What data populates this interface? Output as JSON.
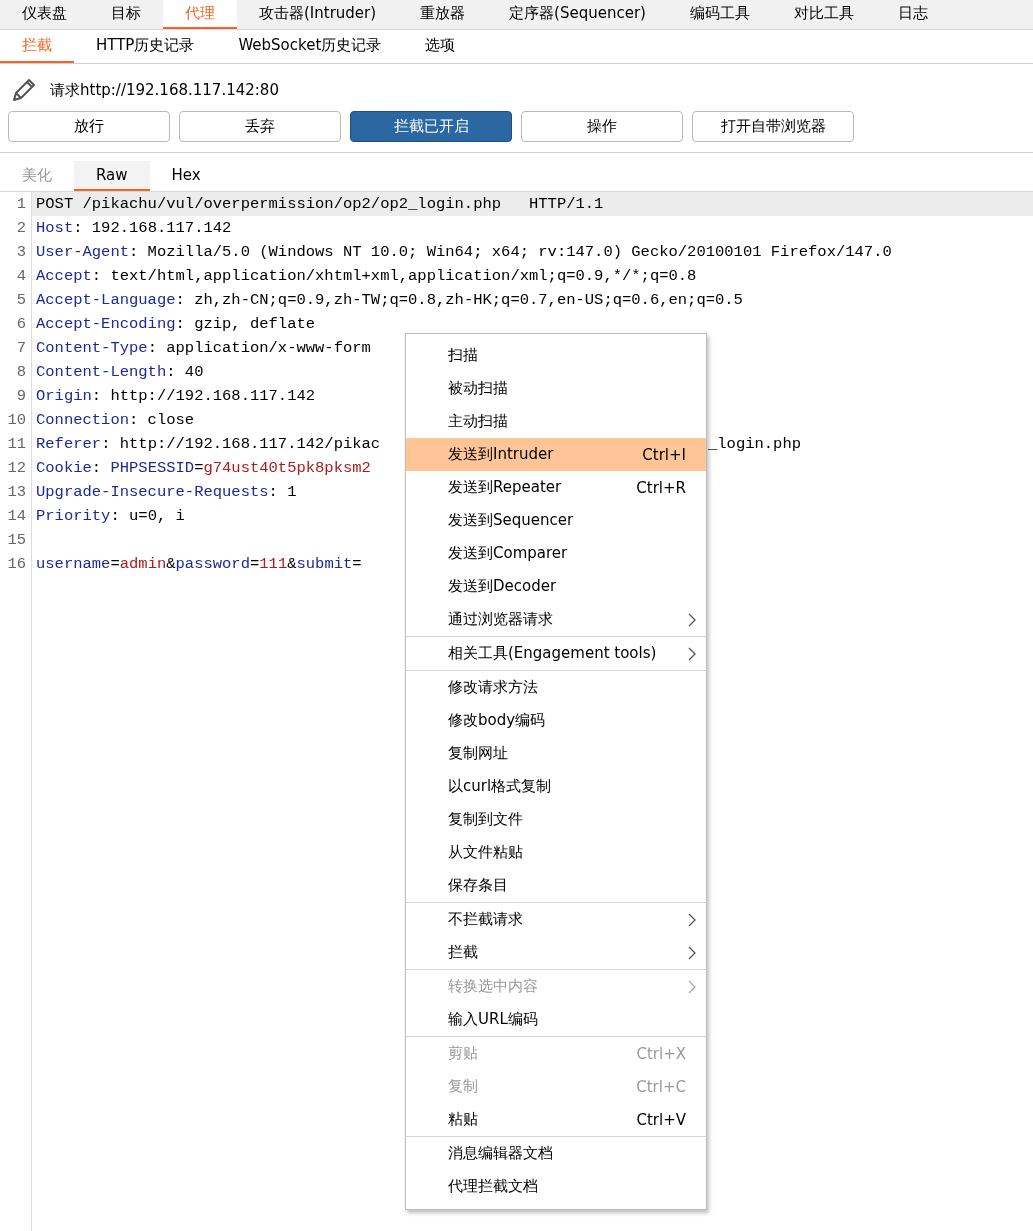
{
  "main_tabs": [
    {
      "label": "仪表盘",
      "selected": false
    },
    {
      "label": "目标",
      "selected": false
    },
    {
      "label": "代理",
      "selected": true
    },
    {
      "label": "攻击器(Intruder)",
      "selected": false
    },
    {
      "label": "重放器",
      "selected": false
    },
    {
      "label": "定序器(Sequencer)",
      "selected": false
    },
    {
      "label": "编码工具",
      "selected": false
    },
    {
      "label": "对比工具",
      "selected": false
    },
    {
      "label": "日志",
      "selected": false
    }
  ],
  "sub_tabs": [
    {
      "label": "拦截",
      "selected": true
    },
    {
      "label": "HTTP历史记录",
      "selected": false
    },
    {
      "label": "WebSocket历史记录",
      "selected": false
    },
    {
      "label": "选项",
      "selected": false
    }
  ],
  "request_label": "请求http://192.168.117.142:80",
  "buttons": [
    {
      "label": "放行",
      "pressed": false
    },
    {
      "label": "丢弃",
      "pressed": false
    },
    {
      "label": "拦截已开启",
      "pressed": true
    },
    {
      "label": "操作",
      "pressed": false
    },
    {
      "label": "打开自带浏览器",
      "pressed": false
    }
  ],
  "editor_tabs": [
    {
      "label": "美化",
      "selected": false,
      "disabled": true
    },
    {
      "label": "Raw",
      "selected": true,
      "disabled": false
    },
    {
      "label": "Hex",
      "selected": false,
      "disabled": false
    }
  ],
  "editor_lines": [
    {
      "number": "1",
      "current": true,
      "tokens": [
        {
          "kind": "plain",
          "text": "POST /pikachu/vul/overpermission/op2/op2_login.php   HTTP/1.1"
        }
      ]
    },
    {
      "number": "2",
      "current": false,
      "tokens": [
        {
          "kind": "key",
          "text": "Host"
        },
        {
          "kind": "plain",
          "text": ": 192.168.117.142"
        }
      ]
    },
    {
      "number": "3",
      "current": false,
      "tokens": [
        {
          "kind": "key",
          "text": "User-Agent"
        },
        {
          "kind": "plain",
          "text": ": Mozilla/5.0 (Windows NT 10.0; Win64; x64; rv:147.0) Gecko/20100101 Firefox/147.0"
        }
      ]
    },
    {
      "number": "4",
      "current": false,
      "tokens": [
        {
          "kind": "key",
          "text": "Accept"
        },
        {
          "kind": "plain",
          "text": ": text/html,application/xhtml+xml,application/xml;q=0.9,*/*;q=0.8"
        }
      ]
    },
    {
      "number": "5",
      "current": false,
      "tokens": [
        {
          "kind": "key",
          "text": "Accept-Language"
        },
        {
          "kind": "plain",
          "text": ": zh,zh-CN;q=0.9,zh-TW;q=0.8,zh-HK;q=0.7,en-US;q=0.6,en;q=0.5"
        }
      ]
    },
    {
      "number": "6",
      "current": false,
      "tokens": [
        {
          "kind": "key",
          "text": "Accept-Encoding"
        },
        {
          "kind": "plain",
          "text": ": gzip, deflate"
        }
      ]
    },
    {
      "number": "7",
      "current": false,
      "tokens": [
        {
          "kind": "key",
          "text": "Content-Type"
        },
        {
          "kind": "plain",
          "text": ": application/x-www-form"
        }
      ]
    },
    {
      "number": "8",
      "current": false,
      "tokens": [
        {
          "kind": "key",
          "text": "Content-Length"
        },
        {
          "kind": "plain",
          "text": ": 40"
        }
      ]
    },
    {
      "number": "9",
      "current": false,
      "tokens": [
        {
          "kind": "key",
          "text": "Origin"
        },
        {
          "kind": "plain",
          "text": ": http://192.168.117.142"
        }
      ]
    },
    {
      "number": "10",
      "current": false,
      "tokens": [
        {
          "kind": "key",
          "text": "Connection"
        },
        {
          "kind": "plain",
          "text": ": close"
        }
      ]
    },
    {
      "number": "11",
      "current": false,
      "tokens": [
        {
          "kind": "key",
          "text": "Referer"
        },
        {
          "kind": "plain",
          "text": ": http://192.168.117.142/pikac"
        },
        {
          "kind": "after_menu",
          "text": "_login.php"
        }
      ]
    },
    {
      "number": "12",
      "current": false,
      "tokens": [
        {
          "kind": "key",
          "text": "Cookie"
        },
        {
          "kind": "plain",
          "text": ": "
        },
        {
          "kind": "key",
          "text": "PHPSESSID"
        },
        {
          "kind": "plain",
          "text": "="
        },
        {
          "kind": "value",
          "text": "g74ust40t5pk8pksm2"
        }
      ]
    },
    {
      "number": "13",
      "current": false,
      "tokens": [
        {
          "kind": "key",
          "text": "Upgrade-Insecure-Requests"
        },
        {
          "kind": "plain",
          "text": ": 1"
        }
      ]
    },
    {
      "number": "14",
      "current": false,
      "tokens": [
        {
          "kind": "key",
          "text": "Priority"
        },
        {
          "kind": "plain",
          "text": ": u=0, i"
        }
      ]
    },
    {
      "number": "15",
      "current": false
    },
    {
      "number": "16",
      "current": false,
      "tokens": [
        {
          "kind": "key",
          "text": "username"
        },
        {
          "kind": "plain",
          "text": "="
        },
        {
          "kind": "value",
          "text": "admin"
        },
        {
          "kind": "plain",
          "text": "&"
        },
        {
          "kind": "key",
          "text": "password"
        },
        {
          "kind": "plain",
          "text": "="
        },
        {
          "kind": "value",
          "text": "111"
        },
        {
          "kind": "plain",
          "text": "&"
        },
        {
          "kind": "key",
          "text": "submit"
        },
        {
          "kind": "plain",
          "text": "="
        }
      ]
    }
  ],
  "context_menu": {
    "groups": [
      {
        "items": [
          {
            "label": "扫描",
            "selected": false,
            "disabled": false,
            "submenu": false
          },
          {
            "label": "被动扫描",
            "selected": false,
            "disabled": false,
            "submenu": false
          },
          {
            "label": "主动扫描",
            "selected": false,
            "disabled": false,
            "submenu": false
          },
          {
            "label": "发送到Intruder",
            "shortcut": "Ctrl+I",
            "selected": true,
            "disabled": false,
            "submenu": false
          },
          {
            "label": "发送到Repeater",
            "shortcut": "Ctrl+R",
            "selected": false,
            "disabled": false,
            "submenu": false
          },
          {
            "label": "发送到Sequencer",
            "selected": false,
            "disabled": false,
            "submenu": false
          },
          {
            "label": "发送到Comparer",
            "selected": false,
            "disabled": false,
            "submenu": false
          },
          {
            "label": "发送到Decoder",
            "selected": false,
            "disabled": false,
            "submenu": false
          },
          {
            "label": "通过浏览器请求",
            "selected": false,
            "disabled": false,
            "submenu": true
          }
        ]
      },
      {
        "items": [
          {
            "label": "相关工具(Engagement tools)",
            "selected": false,
            "disabled": false,
            "submenu": true
          }
        ]
      },
      {
        "items": [
          {
            "label": "修改请求方法",
            "selected": false,
            "disabled": false,
            "submenu": false
          },
          {
            "label": "修改body编码",
            "selected": false,
            "disabled": false,
            "submenu": false
          },
          {
            "label": "复制网址",
            "selected": false,
            "disabled": false,
            "submenu": false
          },
          {
            "label": "以curl格式复制",
            "selected": false,
            "disabled": false,
            "submenu": false
          },
          {
            "label": "复制到文件",
            "selected": false,
            "disabled": false,
            "submenu": false
          },
          {
            "label": "从文件粘贴",
            "selected": false,
            "disabled": false,
            "submenu": false
          },
          {
            "label": "保存条目",
            "selected": false,
            "disabled": false,
            "submenu": false
          }
        ]
      },
      {
        "items": [
          {
            "label": "不拦截请求",
            "selected": false,
            "disabled": false,
            "submenu": true
          },
          {
            "label": "拦截",
            "selected": false,
            "disabled": false,
            "submenu": true
          }
        ]
      },
      {
        "items": [
          {
            "label": "转换选中内容",
            "selected": false,
            "disabled": true,
            "submenu": true
          },
          {
            "label": "输入URL编码",
            "selected": false,
            "disabled": false,
            "submenu": false
          }
        ]
      },
      {
        "items": [
          {
            "label": "剪贴",
            "shortcut": "Ctrl+X",
            "selected": false,
            "disabled": true,
            "submenu": false
          },
          {
            "label": "复制",
            "shortcut": "Ctrl+C",
            "selected": false,
            "disabled": true,
            "submenu": false
          },
          {
            "label": "粘贴",
            "shortcut": "Ctrl+V",
            "selected": false,
            "disabled": false,
            "submenu": false
          }
        ]
      },
      {
        "items": [
          {
            "label": "消息编辑器文档",
            "selected": false,
            "disabled": false,
            "submenu": false
          },
          {
            "label": "代理拦截文档",
            "selected": false,
            "disabled": false,
            "submenu": false
          }
        ]
      }
    ]
  }
}
